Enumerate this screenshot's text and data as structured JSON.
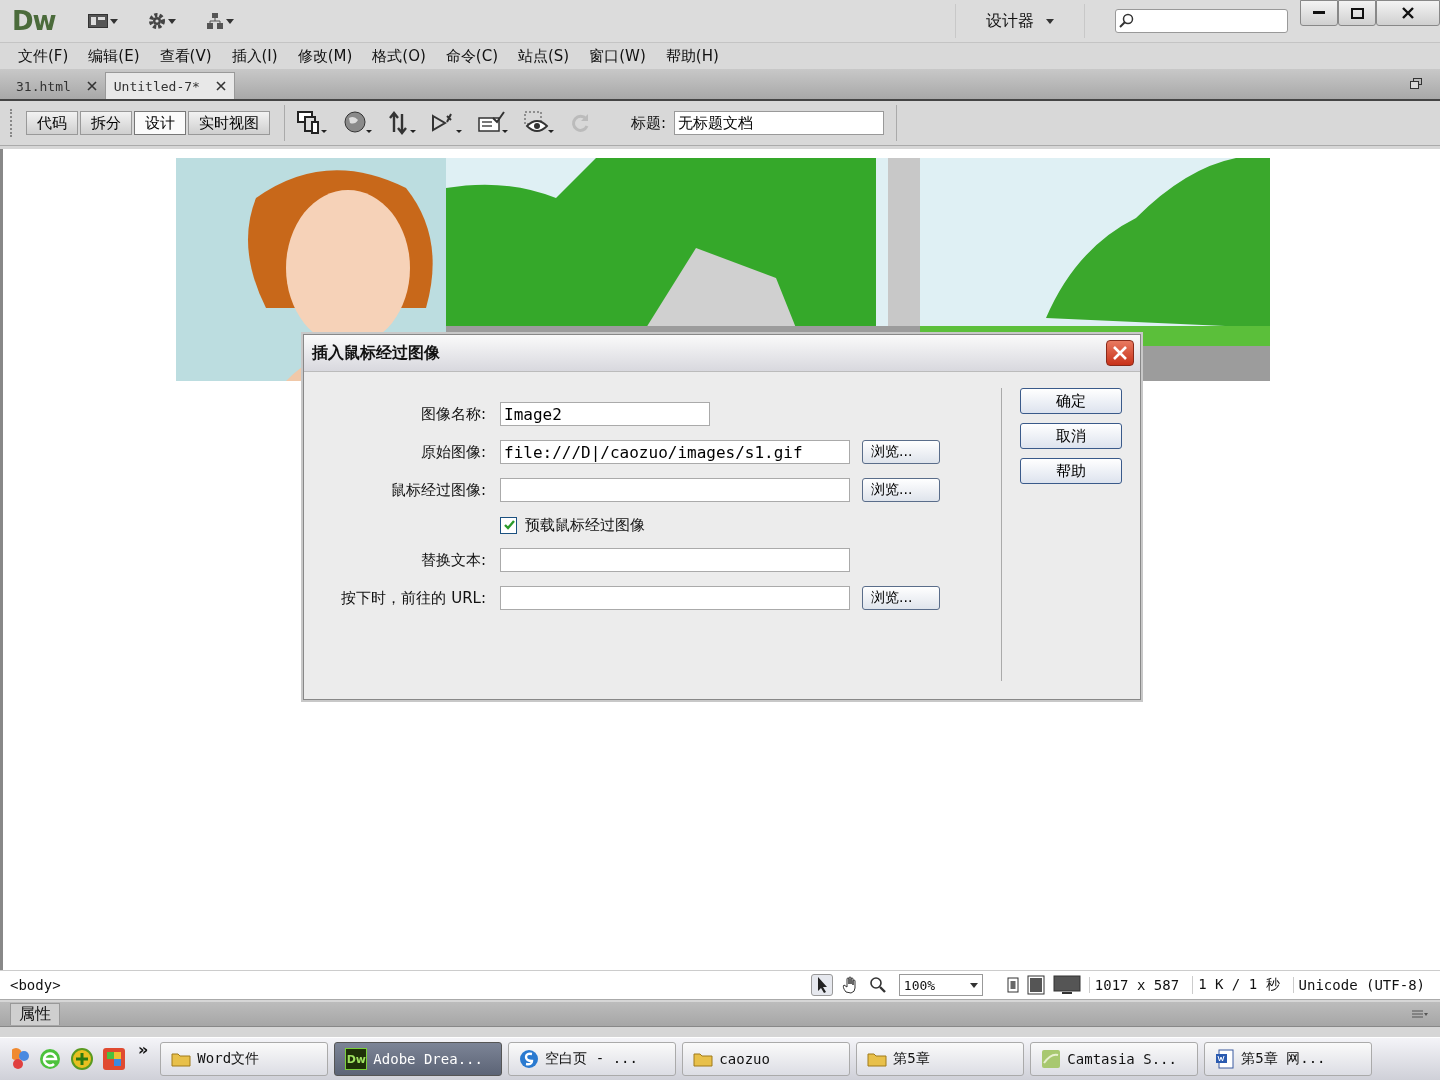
{
  "app_bar": {
    "logo": "Dw",
    "workspace": "设计器"
  },
  "menus": [
    "文件(F)",
    "编辑(E)",
    "查看(V)",
    "插入(I)",
    "修改(M)",
    "格式(O)",
    "命令(C)",
    "站点(S)",
    "窗口(W)",
    "帮助(H)"
  ],
  "doc_tabs": [
    {
      "label": "31.html",
      "selected": false
    },
    {
      "label": "Untitled-7*",
      "selected": true
    }
  ],
  "view_buttons": [
    {
      "label": "代码",
      "selected": false
    },
    {
      "label": "拆分",
      "selected": false
    },
    {
      "label": "设计",
      "selected": true
    },
    {
      "label": "实时视图",
      "selected": false
    }
  ],
  "title_field": {
    "label": "标题:",
    "value": "无标题文档"
  },
  "dialog": {
    "title": "插入鼠标经过图像",
    "fields": [
      {
        "kind": "short",
        "label": "图像名称:",
        "value": "Image2"
      },
      {
        "kind": "text",
        "label": "原始图像:",
        "value": "file:///D|/caozuo/images/s1.gif",
        "browse": "浏览..."
      },
      {
        "kind": "text",
        "label": "鼠标经过图像:",
        "browse": "浏览..."
      },
      {
        "kind": "checkbox",
        "label": "预载鼠标经过图像",
        "checked": true
      },
      {
        "kind": "text",
        "label": "替换文本:"
      },
      {
        "kind": "text",
        "label": "按下时，前往的 URL:",
        "browse": "浏览..."
      }
    ],
    "buttons": [
      "确定",
      "取消",
      "帮助"
    ]
  },
  "status_bar": {
    "tag": "<body>",
    "zoom": "100%",
    "size": "1017 x 587",
    "weight": "1 K / 1 秒",
    "encoding": "Unicode (UTF-8)"
  },
  "properties": {
    "title": "属性"
  },
  "taskbar": {
    "more": "»",
    "tasks": [
      {
        "kind": "folder",
        "label": "Word文件",
        "selected": false
      },
      {
        "kind": "app",
        "badge": "Dw",
        "label": "Adobe Drea...",
        "selected": true
      },
      {
        "kind": "browser",
        "label": "空白页 - ...",
        "selected": false
      },
      {
        "kind": "folder",
        "label": "caozuo",
        "selected": false
      },
      {
        "kind": "folder",
        "label": "第5章",
        "selected": false
      },
      {
        "kind": "recorder",
        "label": "Camtasia S...",
        "selected": false
      },
      {
        "kind": "document",
        "label": "第5章  网...",
        "selected": false
      }
    ]
  }
}
